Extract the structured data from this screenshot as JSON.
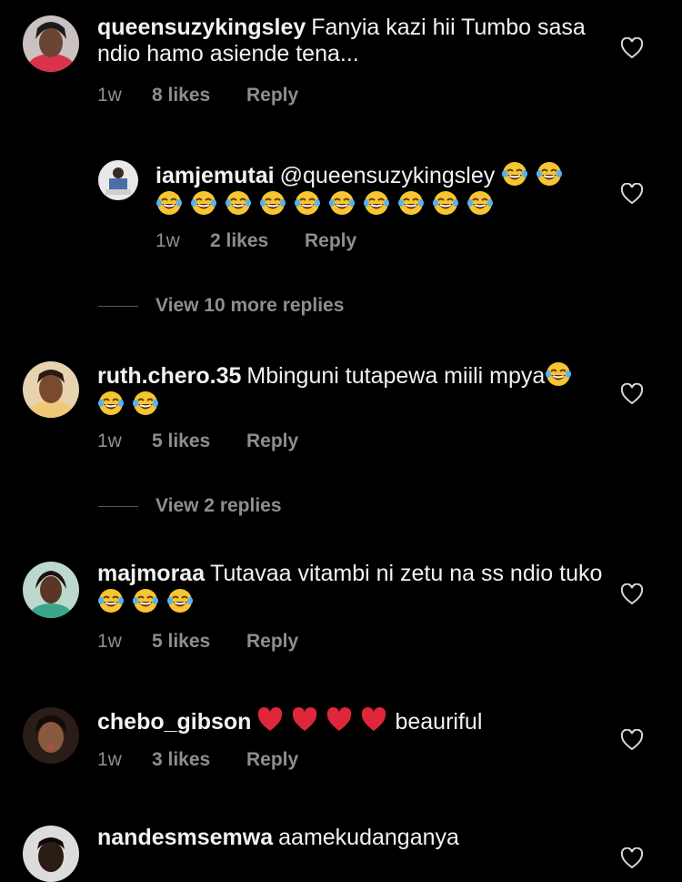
{
  "comments": [
    {
      "username": "queensuzykingsley",
      "text": "Fanyia kazi hii Tumbo sasa ndio hamo asiende tena...",
      "time": "1w",
      "likes": "8 likes",
      "reply": "Reply"
    },
    {
      "username": "iamjemutai",
      "text": "@queensuzykingsley",
      "time": "1w",
      "likes": "2 likes",
      "reply": "Reply",
      "emoji": "face-with-tears-of-joy",
      "emoji_count": 12
    },
    {
      "username": "ruth.chero.35",
      "text": "Mbinguni tutapewa miili mpya",
      "time": "1w",
      "likes": "5 likes",
      "reply": "Reply",
      "emoji": "face-with-tears-of-joy",
      "emoji_count": 3
    },
    {
      "username": "majmoraa",
      "text": "Tutavaa vitambi ni zetu na ss ndio tuko",
      "time": "1w",
      "likes": "5 likes",
      "reply": "Reply",
      "emoji": "face-with-tears-of-joy",
      "emoji_count": 3
    },
    {
      "username": "chebo_gibson",
      "text": "beauriful",
      "time": "1w",
      "likes": "3 likes",
      "reply": "Reply",
      "emoji": "red-heart",
      "emoji_count": 4
    },
    {
      "username": "nandesmsemwa",
      "text": "aamekudanganya"
    }
  ],
  "view_replies": [
    "View 10 more replies",
    "View 2 replies"
  ],
  "colors": {
    "background": "#000000",
    "text": "#f2f2f2",
    "muted": "#8e8e8e"
  }
}
